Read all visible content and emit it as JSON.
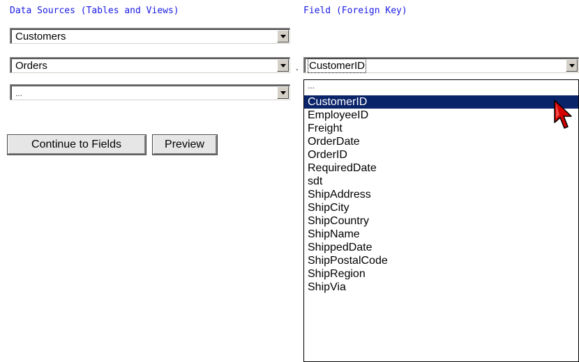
{
  "left_section": {
    "label": "Data Sources (Tables and Views)",
    "selects": [
      {
        "value": "Customers"
      },
      {
        "value": "Orders"
      },
      {
        "value": "..."
      }
    ]
  },
  "right_section": {
    "label": "Field (Foreign Key)",
    "separator": ".",
    "select_value": "CustomerID",
    "options": [
      "...",
      "CustomerID",
      "EmployeeID",
      "Freight",
      "OrderDate",
      "OrderID",
      "RequiredDate",
      "sdt",
      "ShipAddress",
      "ShipCity",
      "ShipCountry",
      "ShipName",
      "ShippedDate",
      "ShipPostalCode",
      "ShipRegion",
      "ShipVia"
    ],
    "selected_index": 1
  },
  "buttons": {
    "continue_label": "Continue to Fields",
    "preview_label": "Preview"
  },
  "colors": {
    "label_blue": "#1a1ae6",
    "selection_bg": "#0a246a",
    "cursor_red": "#d40000"
  },
  "icons": {
    "cursor": "pointer-arrow-icon",
    "dropdown_arrow": "chevron-down-icon"
  }
}
